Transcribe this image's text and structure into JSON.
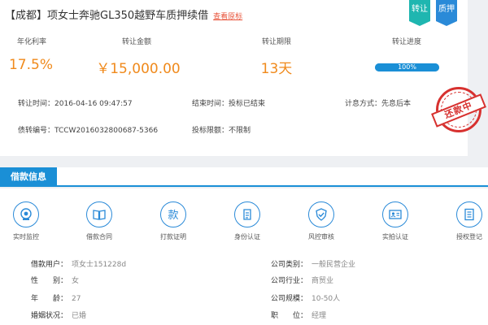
{
  "title": {
    "region": "【成都】",
    "name": "项女士奔驰GL350越野车质押续借",
    "view_link": "查看原标"
  },
  "badges": {
    "transfer": "转让",
    "pledge": "质押"
  },
  "stats": {
    "rate_label": "年化利率",
    "rate_value": "17.5%",
    "amount_label": "转让金额",
    "amount_value": "￥15,000.00",
    "term_label": "转让期限",
    "term_value": "13天",
    "progress_label": "转让进度",
    "progress_text": "100%",
    "progress_fraction": 1.0
  },
  "details": {
    "transfer_time_label": "转让时间：",
    "transfer_time_value": "2016-04-16 09:47:57",
    "end_time_label": "结束时间：",
    "end_time_value": "投标已结束",
    "interest_label": "计息方式：",
    "interest_value": "先息后本",
    "debt_no_label": "债转编号：",
    "debt_no_value": "TCCW2016032800687-5366",
    "limit_label": "投标限额：",
    "limit_value": "不限制"
  },
  "stamp": {
    "text": "还款中",
    "color": "#d7312f"
  },
  "section": {
    "tab_label": "借款信息"
  },
  "icons": [
    {
      "label": "实时监控",
      "icon": "camera-icon"
    },
    {
      "label": "借款合同",
      "icon": "book-icon"
    },
    {
      "label": "打款证明",
      "icon": "payment-icon",
      "glyph": "款"
    },
    {
      "label": "身份认证",
      "icon": "id-card-icon"
    },
    {
      "label": "风控审核",
      "icon": "shield-check-icon"
    },
    {
      "label": "实拍认证",
      "icon": "photo-id-icon"
    },
    {
      "label": "授权登记",
      "icon": "document-icon"
    }
  ],
  "borrower": {
    "user_label": "借款用户：",
    "user_value": "项女士151228d",
    "gender_label": "性　　别：",
    "gender_value": "女",
    "age_label": "年　　龄：",
    "age_value": "27",
    "marital_label": "婚姻状况：",
    "marital_value": "已婚",
    "company_type_label": "公司类别：",
    "company_type_value": "一般民营企业",
    "industry_label": "公司行业：",
    "industry_value": "商贸业",
    "scale_label": "公司规模：",
    "scale_value": "10-50人",
    "position_label": "职　　位：",
    "position_value": "经理"
  },
  "colors": {
    "accent": "#1a8fd6",
    "orange": "#f08a1c",
    "teal": "#1fb6b0"
  }
}
